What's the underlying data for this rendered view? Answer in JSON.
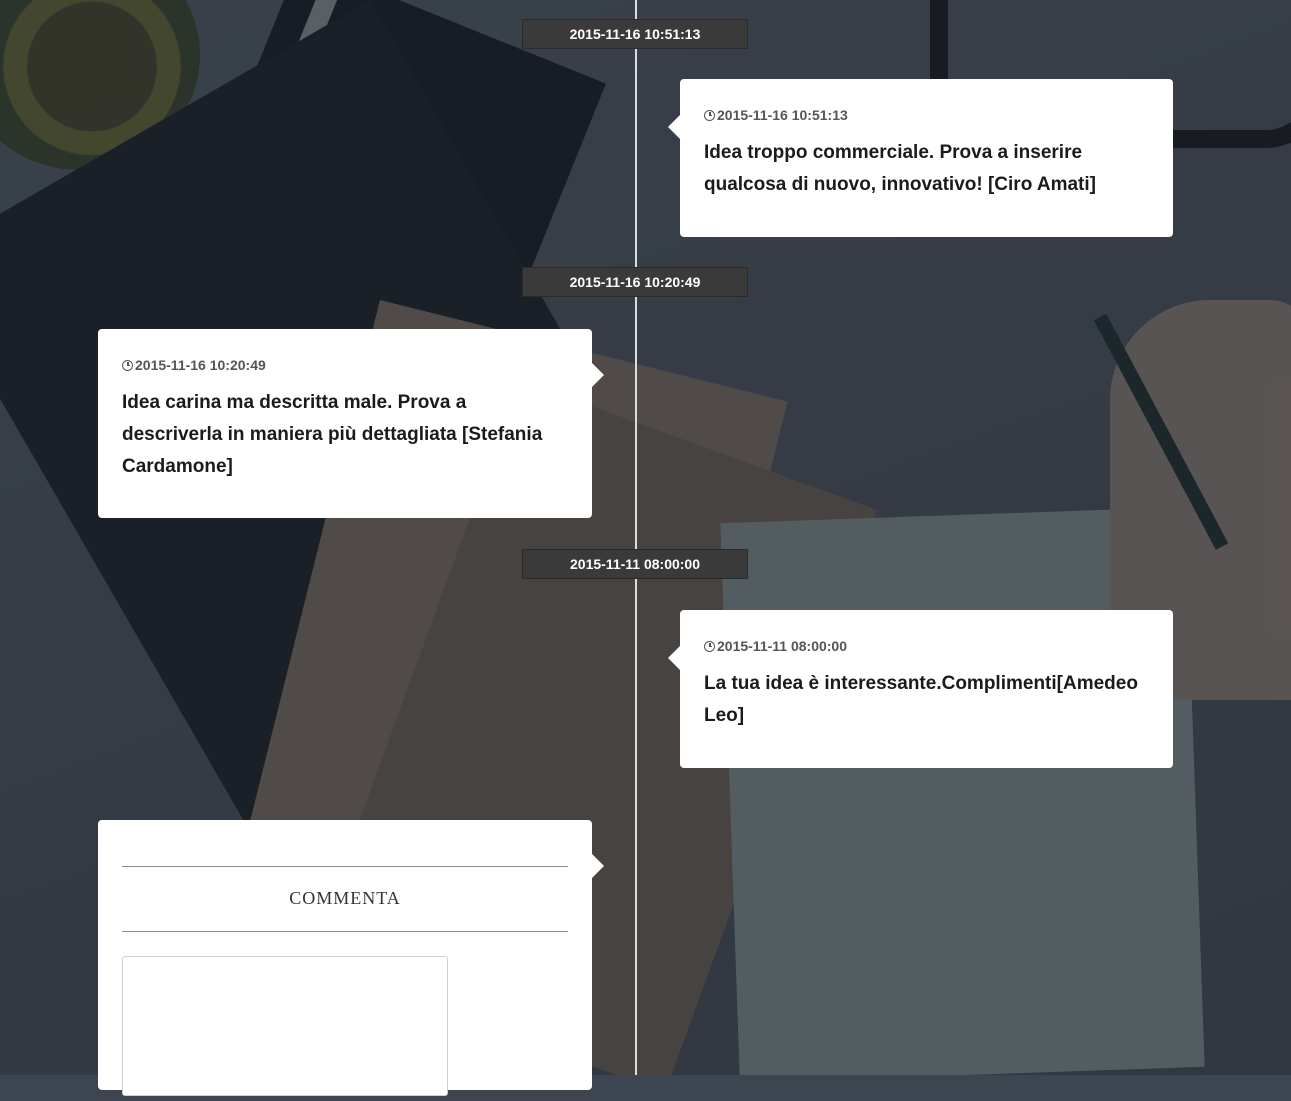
{
  "timeline": {
    "entries": [
      {
        "date_tag": "2015-11-16 10:51:13",
        "timestamp": "2015-11-16 10:51:13",
        "text": "Idea troppo commerciale. Prova a inserire qualcosa di nuovo, innovativo!  [Ciro Amati]"
      },
      {
        "date_tag": "2015-11-16 10:20:49",
        "timestamp": "2015-11-16 10:20:49",
        "text": "Idea carina ma descritta male. Prova a descriverla in maniera più dettagliata [Stefania Cardamone]"
      },
      {
        "date_tag": "2015-11-11 08:00:00",
        "timestamp": "2015-11-11 08:00:00",
        "text": "La tua idea è interessante.Complimenti[Amedeo Leo]"
      }
    ]
  },
  "comment_form": {
    "title": "COMMENTA",
    "textarea_value": ""
  },
  "icons": {
    "timestamp_icon": "clock-icon"
  },
  "colors": {
    "card_background": "#ffffff",
    "date_tag_background": "#3a3a3a",
    "timeline_line": "#d9dde0"
  }
}
